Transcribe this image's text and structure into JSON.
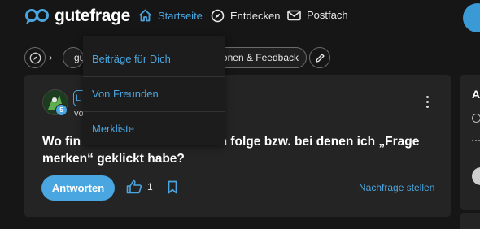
{
  "header": {
    "logo_text": "gutefrage",
    "nav": [
      {
        "label": "Startseite",
        "icon": "home-icon"
      },
      {
        "label": "Entdecken",
        "icon": "compass-icon"
      },
      {
        "label": "Postfach",
        "icon": "mail-icon"
      }
    ]
  },
  "breadcrumb": {
    "chip1_label": "gu",
    "chip2_label": "tionen & Feedback"
  },
  "dropdown": {
    "items": [
      "Beiträge für Dich",
      "Von Freunden",
      "Merkliste"
    ]
  },
  "question": {
    "user_badge": "5",
    "user_chip": "L",
    "user_sub": "vo",
    "title": "Wo fin                         denen ich folge bzw. bei denen ich „Frage merken“ geklickt habe?",
    "answer_label": "Antworten",
    "like_count": "1",
    "nachfrage_label": "Nachfrage stellen"
  },
  "sidebar": {
    "heading": "A"
  },
  "colors": {
    "accent": "#4aa6e0",
    "background": "#161616",
    "card": "#242424"
  }
}
